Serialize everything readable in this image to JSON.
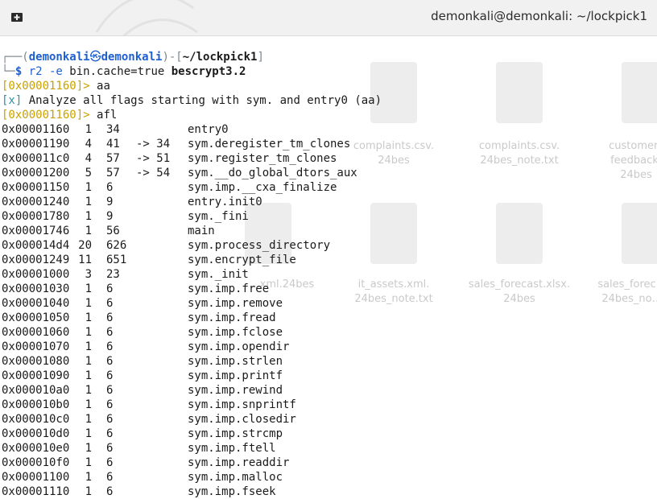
{
  "window": {
    "title": "demonkali@demonkali: ~/lockpick1"
  },
  "desktop_files": [
    {
      "name": "complaints.csv.\n24bes"
    },
    {
      "name": "complaints.csv.\n24bes_note.txt"
    },
    {
      "name": "customer_\nfeedback.\n24bes"
    },
    {
      "name": "…xml.24bes"
    },
    {
      "name": "it_assets.xml.\n24bes_note.txt"
    },
    {
      "name": "sales_forecast.xlsx.\n24bes"
    },
    {
      "name": "sales_forec…\n24bes_no…"
    }
  ],
  "terminal": {
    "prompt_user": "demonkali",
    "prompt_host": "demonkali",
    "prompt_path": "~/lockpick1",
    "command_prefix": "r2 -e ",
    "command_arg": "bin.cache=true ",
    "command_file": "bescrypt3.2",
    "r2_prompt_1": "[0x00001160]>",
    "cmd_1": "aa",
    "analyze_tag": "[x]",
    "analyze_msg": "Analyze all flags starting with sym. and entry0 (aa)",
    "r2_prompt_2": "[0x00001160]>",
    "cmd_2": "afl",
    "functions": [
      {
        "addr": "0x00001160",
        "nbbs": "1",
        "size": "34",
        "xref": "",
        "name": "entry0"
      },
      {
        "addr": "0x00001190",
        "nbbs": "4",
        "size": "41",
        "xref": "-> 34",
        "name": "sym.deregister_tm_clones"
      },
      {
        "addr": "0x000011c0",
        "nbbs": "4",
        "size": "57",
        "xref": "-> 51",
        "name": "sym.register_tm_clones"
      },
      {
        "addr": "0x00001200",
        "nbbs": "5",
        "size": "57",
        "xref": "-> 54",
        "name": "sym.__do_global_dtors_aux"
      },
      {
        "addr": "0x00001150",
        "nbbs": "1",
        "size": "6",
        "xref": "",
        "name": "sym.imp.__cxa_finalize"
      },
      {
        "addr": "0x00001240",
        "nbbs": "1",
        "size": "9",
        "xref": "",
        "name": "entry.init0"
      },
      {
        "addr": "0x00001780",
        "nbbs": "1",
        "size": "9",
        "xref": "",
        "name": "sym._fini"
      },
      {
        "addr": "0x00001746",
        "nbbs": "1",
        "size": "56",
        "xref": "",
        "name": "main"
      },
      {
        "addr": "0x000014d4",
        "nbbs": "20",
        "size": "626",
        "xref": "",
        "name": "sym.process_directory"
      },
      {
        "addr": "0x00001249",
        "nbbs": "11",
        "size": "651",
        "xref": "",
        "name": "sym.encrypt_file"
      },
      {
        "addr": "0x00001000",
        "nbbs": "3",
        "size": "23",
        "xref": "",
        "name": "sym._init"
      },
      {
        "addr": "0x00001030",
        "nbbs": "1",
        "size": "6",
        "xref": "",
        "name": "sym.imp.free"
      },
      {
        "addr": "0x00001040",
        "nbbs": "1",
        "size": "6",
        "xref": "",
        "name": "sym.imp.remove"
      },
      {
        "addr": "0x00001050",
        "nbbs": "1",
        "size": "6",
        "xref": "",
        "name": "sym.imp.fread"
      },
      {
        "addr": "0x00001060",
        "nbbs": "1",
        "size": "6",
        "xref": "",
        "name": "sym.imp.fclose"
      },
      {
        "addr": "0x00001070",
        "nbbs": "1",
        "size": "6",
        "xref": "",
        "name": "sym.imp.opendir"
      },
      {
        "addr": "0x00001080",
        "nbbs": "1",
        "size": "6",
        "xref": "",
        "name": "sym.imp.strlen"
      },
      {
        "addr": "0x00001090",
        "nbbs": "1",
        "size": "6",
        "xref": "",
        "name": "sym.imp.printf"
      },
      {
        "addr": "0x000010a0",
        "nbbs": "1",
        "size": "6",
        "xref": "",
        "name": "sym.imp.rewind"
      },
      {
        "addr": "0x000010b0",
        "nbbs": "1",
        "size": "6",
        "xref": "",
        "name": "sym.imp.snprintf"
      },
      {
        "addr": "0x000010c0",
        "nbbs": "1",
        "size": "6",
        "xref": "",
        "name": "sym.imp.closedir"
      },
      {
        "addr": "0x000010d0",
        "nbbs": "1",
        "size": "6",
        "xref": "",
        "name": "sym.imp.strcmp"
      },
      {
        "addr": "0x000010e0",
        "nbbs": "1",
        "size": "6",
        "xref": "",
        "name": "sym.imp.ftell"
      },
      {
        "addr": "0x000010f0",
        "nbbs": "1",
        "size": "6",
        "xref": "",
        "name": "sym.imp.readdir"
      },
      {
        "addr": "0x00001100",
        "nbbs": "1",
        "size": "6",
        "xref": "",
        "name": "sym.imp.malloc"
      },
      {
        "addr": "0x00001110",
        "nbbs": "1",
        "size": "6",
        "xref": "",
        "name": "sym.imp.fseek"
      }
    ]
  }
}
